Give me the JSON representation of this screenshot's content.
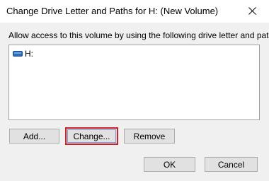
{
  "window": {
    "title": "Change Drive Letter and Paths for H: (New Volume)",
    "close_icon": "close-icon"
  },
  "prompt": "Allow access to this volume by using the following drive letter and paths:",
  "list": {
    "items": [
      {
        "label": "H:",
        "icon": "drive-icon"
      }
    ]
  },
  "buttons": {
    "add": "Add...",
    "change": "Change...",
    "remove": "Remove",
    "ok": "OK",
    "cancel": "Cancel"
  },
  "colors": {
    "highlight_border": "#d0202a",
    "drive_icon": "#2d6db5"
  }
}
